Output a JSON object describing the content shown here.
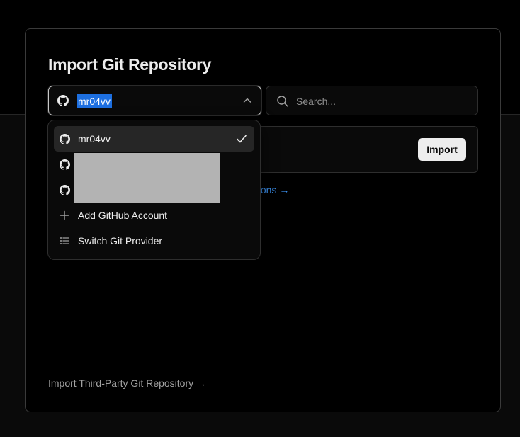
{
  "page": {
    "title": "Import Git Repository"
  },
  "account_select": {
    "selected": "mr04vv",
    "icon": "github-icon",
    "selection_color": "#1d6fe0"
  },
  "search": {
    "placeholder": "Search..."
  },
  "repo_row": {
    "import_label": "Import"
  },
  "permissions_link": {
    "label": "missions →"
  },
  "dropdown": {
    "items": [
      {
        "label": "mr04vv",
        "icon": "github-icon",
        "selected": true
      },
      {
        "label": "",
        "icon": "github-icon",
        "redacted": true
      },
      {
        "label": "",
        "icon": "github-icon",
        "redacted": true
      },
      {
        "label": "Add GitHub Account",
        "icon": "plus-icon"
      },
      {
        "label": "Switch Git Provider",
        "icon": "list-icon"
      }
    ]
  },
  "footer": {
    "third_party_label": "Import Third-Party Git Repository →"
  },
  "colors": {
    "background": "#000000",
    "link": "#3b8eea",
    "button_bg": "#ededed"
  }
}
